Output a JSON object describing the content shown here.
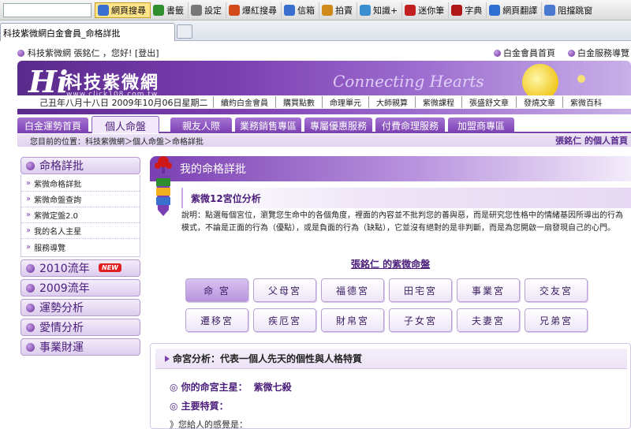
{
  "browser": {
    "toolbar_items": [
      {
        "label": "網頁搜尋",
        "icon": "search-icon",
        "color": "#3a6fd0",
        "highlight": true
      },
      {
        "label": "書籤",
        "icon": "bookmark-icon",
        "color": "#2f8f2f"
      },
      {
        "label": "設定",
        "icon": "gear-icon",
        "color": "#777777"
      },
      {
        "label": "爆紅搜尋",
        "icon": "fire-icon",
        "color": "#d24a1a"
      },
      {
        "label": "信箱",
        "icon": "mail-icon",
        "color": "#3a6fd0"
      },
      {
        "label": "拍賣",
        "icon": "auction-icon",
        "color": "#d08a1a"
      },
      {
        "label": "知識+",
        "icon": "knowledge-icon",
        "color": "#3a8fd0"
      },
      {
        "label": "迷你筆",
        "icon": "pen-icon",
        "color": "#c22020"
      },
      {
        "label": "字典",
        "icon": "dictionary-icon",
        "color": "#b01818"
      },
      {
        "label": "網頁翻譯",
        "icon": "translate-icon",
        "color": "#2f6fcf"
      },
      {
        "label": "阻擋跳窗",
        "icon": "popup-block-icon",
        "color": "#4a7acf"
      }
    ],
    "tab_title": "科技紫微網白金會員_命格詳批"
  },
  "topbar": {
    "greeting": "科技紫微網 張銘仁 ，您好! [登出]",
    "links": [
      "白金會員首頁",
      "白金服務導覽"
    ]
  },
  "banner": {
    "logo_hi": "Hi",
    "logo_text": "科技紫微網",
    "logo_url": "www.click108.com.tw",
    "slogan": "Connecting Hearts"
  },
  "navstrip": {
    "date": "己丑年八月十八日 2009年10月06日星期二",
    "links": [
      "續約白金會員",
      "購買點數",
      "命理單元",
      "大師親算",
      "紫微課程",
      "張盛舒文章",
      "發燒文章",
      "紫微百科"
    ]
  },
  "main_tabs": [
    {
      "label": "白金運勢首頁",
      "active": false
    },
    {
      "label": "個人命盤",
      "active": true
    },
    {
      "label": "親友人際",
      "active": false
    },
    {
      "label": "業務銷售專區",
      "active": false
    },
    {
      "label": "專屬優惠服務",
      "active": false
    },
    {
      "label": "付費命理服務",
      "active": false
    },
    {
      "label": "加盟商專區",
      "active": false
    }
  ],
  "breadcrumb": {
    "path": "您目前的位置：科技紫微網＞個人命盤＞命格詳批",
    "user_label": "張銘仁 的個人首頁"
  },
  "sidebar": {
    "sections": [
      {
        "label": "命格詳批",
        "items": [
          "紫微命格詳批",
          "紫微命盤查詢",
          "紫微定盤2.0",
          "我的名人主星",
          "服務導覽"
        ]
      },
      {
        "label": "2010流年",
        "badge": "NEW"
      },
      {
        "label": "2009流年"
      },
      {
        "label": "運勢分析"
      },
      {
        "label": "愛情分析"
      },
      {
        "label": "事業財運"
      }
    ]
  },
  "content": {
    "section_title": "我的命格詳批",
    "sub_title": "紫微12宮位分析",
    "description": "說明：點選每個宮位，瀏覽您生命中的各個角度，裡面的內容並不批判您的善與惡，而是研究您性格中的情緒基因所導出的行為模式，不論是正面的行為（優點），或是負面的行為（缺點），它並沒有絕對的是非判斷，而是為您開啟一扇發現自己的心門。",
    "chart_title": "張銘仁 的紫微命盤",
    "palaces": [
      "命 宮",
      "父母宮",
      "福德宮",
      "田宅宮",
      "事業宮",
      "交友宮",
      "遷移宮",
      "疾厄宮",
      "財帛宮",
      "子女宮",
      "夫妻宮",
      "兄弟宮"
    ],
    "active_palace": 0,
    "analysis": {
      "heading": "命宮分析：代表一個人先天的個性與人格特質",
      "main_star_label": "◎ 你的命宮主星：",
      "main_star_value": "紫微七殺",
      "features_label": "◎ 主要特質：",
      "note": "》您給人的感覺是："
    }
  },
  "colors": {
    "accent": "#7a3fb2",
    "accent_dark": "#4a1d7a",
    "accent_light": "#ece2f6"
  }
}
